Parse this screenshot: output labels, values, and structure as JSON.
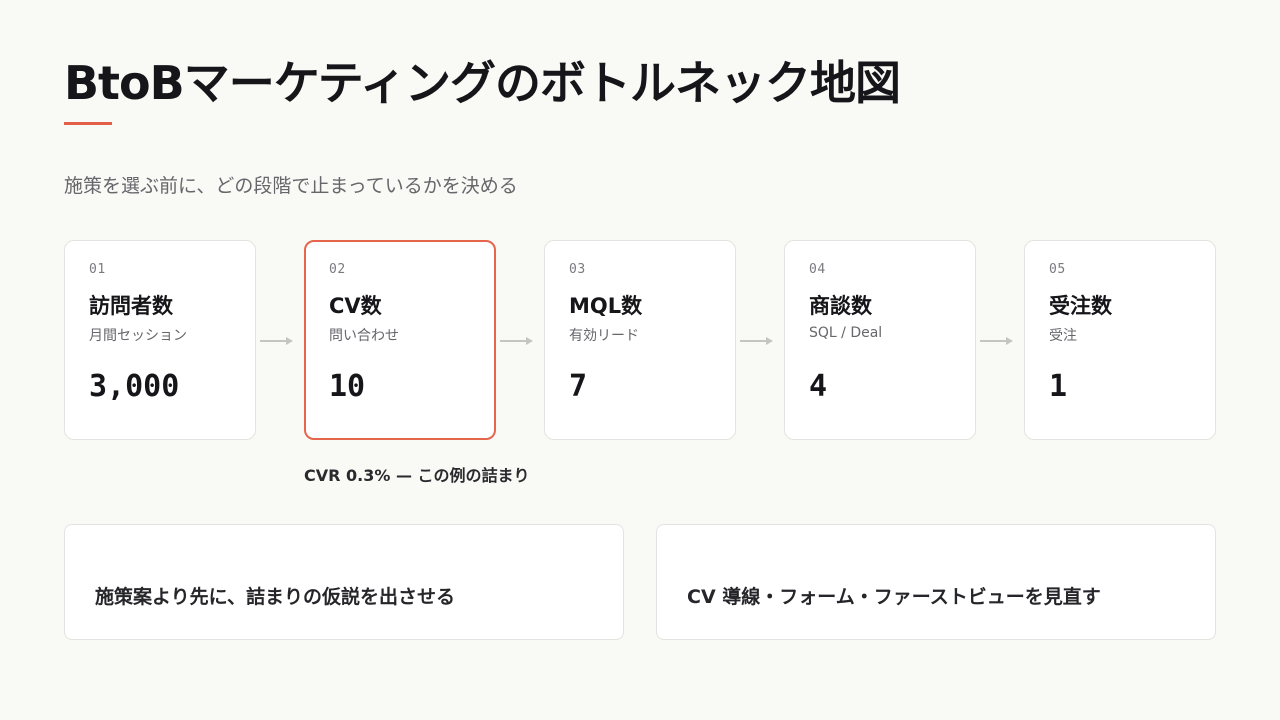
{
  "title": "BtoBマーケティングのボトルネック地図",
  "subtitle": "施策を選ぶ前に、どの段階で止まっているかを決める",
  "accent_color": "#e45f47",
  "stages": [
    {
      "num": "01",
      "name": "訪問者数",
      "sub": "月間セッション",
      "value": "3,000"
    },
    {
      "num": "02",
      "name": "CV数",
      "sub": "問い合わせ",
      "value": "10"
    },
    {
      "num": "03",
      "name": "MQL数",
      "sub": "有効リード",
      "value": "7"
    },
    {
      "num": "04",
      "name": "商談数",
      "sub": "SQL / Deal",
      "value": "4"
    },
    {
      "num": "05",
      "name": "受注数",
      "sub": "受注",
      "value": "1"
    }
  ],
  "highlight_stage": "02",
  "bottleneck_note": "CVR 0.3% — この例の詰まり",
  "cards": [
    {
      "text": "施策案より先に、詰まりの仮説を出させる"
    },
    {
      "text": "CV 導線・フォーム・ファーストビューを見直す"
    }
  ]
}
